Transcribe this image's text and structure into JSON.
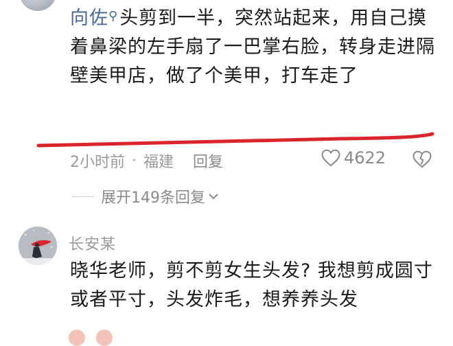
{
  "comment1": {
    "author": "向佐",
    "text": "头剪到一半，突然站起来，用自己摸着鼻梁的左手扇了一巴掌右脸，转身走进隔壁美甲店，做了个美甲，打车走了",
    "time": "2小时前",
    "location": "福建",
    "reply_label": "回复",
    "likes": "4622",
    "expand_replies": "展开149条回复"
  },
  "comment2": {
    "author": "长安某",
    "text": "晓华老师，剪不剪女生头发? 我想剪成圆寸或者平寸，头发炸毛，想养养头发"
  },
  "colors": {
    "accent_author": "#4a6b95",
    "underline_red": "#d9252b",
    "meta_gray": "#9a9a9a"
  },
  "icons": [
    "search-icon",
    "heart-icon",
    "dislike-heart-icon",
    "chevron-down-icon"
  ]
}
